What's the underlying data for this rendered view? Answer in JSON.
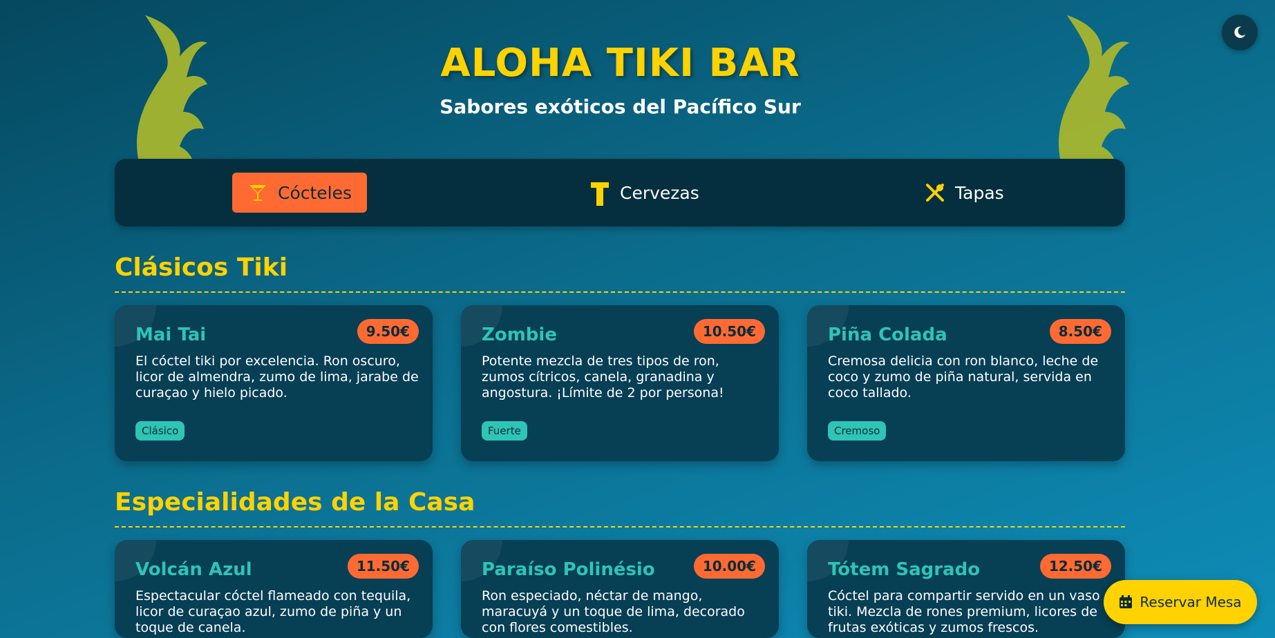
{
  "header": {
    "title": "ALOHA TIKI BAR",
    "subtitle": "Sabores exóticos del Pacífico Sur"
  },
  "theme_toggle": {
    "icon": "moon-icon"
  },
  "nav": {
    "items": [
      {
        "label": "Cócteles",
        "icon": "cocktail-icon",
        "active": true
      },
      {
        "label": "Cervezas",
        "icon": "beer-icon",
        "active": false
      },
      {
        "label": "Tapas",
        "icon": "utensils-icon",
        "active": false
      }
    ]
  },
  "sections": [
    {
      "title": "Clásicos Tiki",
      "items": [
        {
          "name": "Mai Tai",
          "price": "9.50€",
          "description": "El cóctel tiki por excelencia. Ron oscuro, licor de almendra, zumo de lima, jarabe de curaçao y hielo picado.",
          "tag": "Clásico"
        },
        {
          "name": "Zombie",
          "price": "10.50€",
          "description": "Potente mezcla de tres tipos de ron, zumos cítricos, canela, granadina y angostura. ¡Límite de 2 por persona!",
          "tag": "Fuerte"
        },
        {
          "name": "Piña Colada",
          "price": "8.50€",
          "description": "Cremosa delicia con ron blanco, leche de coco y zumo de piña natural, servida en coco tallado.",
          "tag": "Cremoso"
        }
      ]
    },
    {
      "title": "Especialidades de la Casa",
      "items": [
        {
          "name": "Volcán Azul",
          "price": "11.50€",
          "description": "Espectacular cóctel flameado con tequila, licor de curaçao azul, zumo de piña y un toque de canela."
        },
        {
          "name": "Paraíso Polinésio",
          "price": "10.00€",
          "description": "Ron especiado, néctar de mango, maracuyá y un toque de lima, decorado con flores comestibles."
        },
        {
          "name": "Tótem Sagrado",
          "price": "12.50€",
          "description": "Cóctel para compartir servido en un vaso tiki. Mezcla de rones premium, licores de frutas exóticas y zumos frescos."
        }
      ]
    }
  ],
  "reserve_button": {
    "label": "Reservar Mesa",
    "icon": "calendar-icon"
  },
  "colors": {
    "accent_yellow": "#ffd200",
    "accent_orange": "#ff6a33",
    "accent_teal": "#2ec4b6",
    "card_bg": "#073f55",
    "nav_bg": "#052f3e"
  }
}
